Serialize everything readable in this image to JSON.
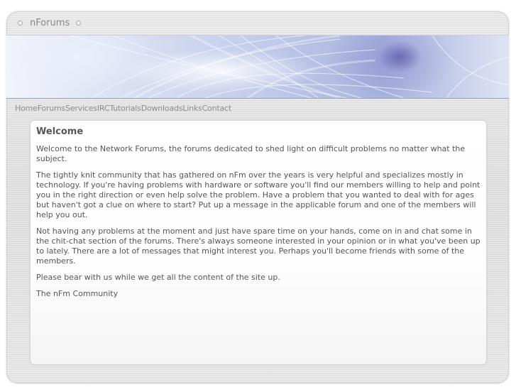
{
  "header": {
    "site_title": "nForums"
  },
  "nav": {
    "items": [
      "Home",
      "Forums",
      "Services",
      "IRC",
      "Tutorials",
      "Downloads",
      "Links",
      "Contact"
    ]
  },
  "main": {
    "heading": "Welcome",
    "paragraphs": [
      "Welcome to the Network Forums, the forums dedicated to shed light on difficult problems no matter what the subject.",
      "The tightly knit community that has gathered on nFm over the years is very helpful and specializes mostly in technology. If you're having problems with hardware or software you'll find our members willing to help and point you in the right direction or even help solve the problem. Have a problem that you wanted to deal with for ages but haven't got a clue on where to start? Put up a message in the applicable forum and one of the members will help you out.",
      "Not having any problems at the moment and just have spare time on your hands, come on in and chat some in the chit-chat section of the forums. There's always someone interested in your opinion or in what you've been up to lately. There are a lot of messages that might interest you. Perhaps you'll become friends with some of the members.",
      "Please bear with us while we get all the content of the site up.",
      "The nFm Community"
    ]
  },
  "colors": {
    "text": "#555555",
    "nav_text": "#8c8c8c",
    "frame": "#e3e3e3",
    "banner_accent": "#b7c2e4"
  }
}
